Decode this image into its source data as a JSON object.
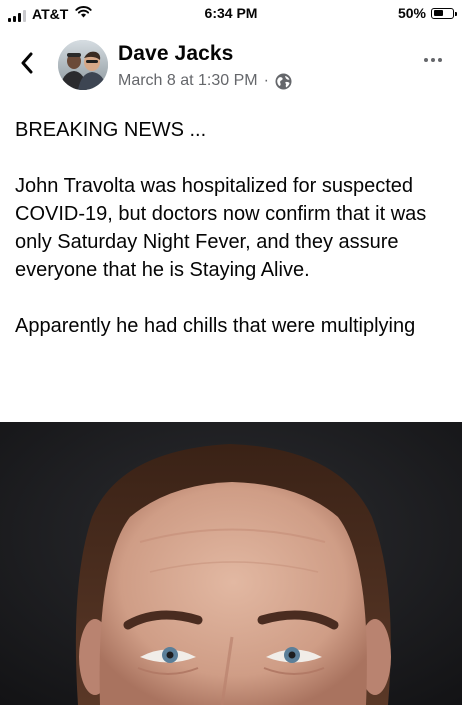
{
  "status_bar": {
    "carrier": "AT&T",
    "time": "6:34 PM",
    "battery_percent": "50%",
    "battery_level": 0.5,
    "signal_bars": 3
  },
  "post": {
    "author": "Dave Jacks",
    "timestamp": "March 8 at 1:30 PM",
    "separator": "·",
    "audience_icon": "globe-icon",
    "paragraphs": [
      "BREAKING NEWS ...",
      "John Travolta was hospitalized for suspected COVID-19, but doctors now confirm that it was only Saturday Night Fever, and they assure everyone that he is Staying Alive.",
      "Apparently he had chills that were multiplying"
    ]
  },
  "colors": {
    "text": "#050505",
    "secondary_text": "#65676b",
    "photo_background": "#1b1b1e"
  }
}
